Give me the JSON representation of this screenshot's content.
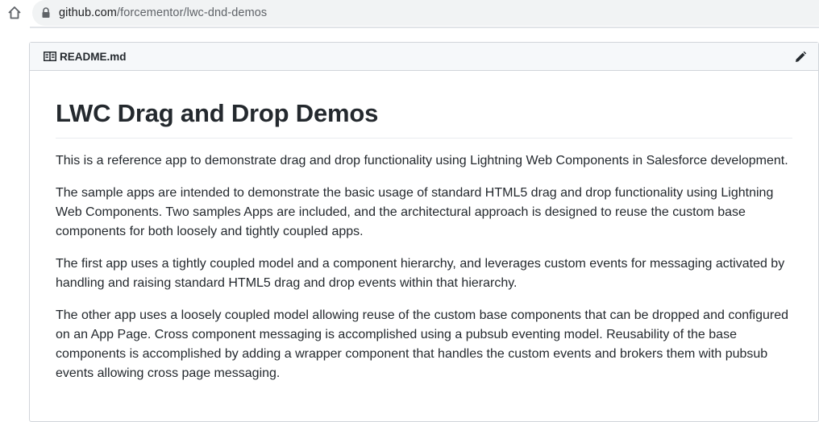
{
  "browser": {
    "url_host": "github.com",
    "url_path": "/forcementor/lwc-dnd-demos"
  },
  "readme": {
    "filename": "README.md",
    "heading": "LWC Drag and Drop Demos",
    "paragraphs": [
      "This is a reference app to demonstrate drag and drop functionality using Lightning Web Components in Salesforce development.",
      "The sample apps are intended to demonstrate the basic usage of standard HTML5 drag and drop functionality using Lightning Web Components. Two samples Apps are included, and the architectural approach is designed to reuse the custom base components for both loosely and tightly coupled apps.",
      "The first app uses a tightly coupled model and a component hierarchy, and leverages custom events for messaging activated by handling and raising standard HTML5 drag and drop events within that hierarchy.",
      "The other app uses a loosely coupled model allowing reuse of the custom base components that can be dropped and configured on an App Page. Cross component messaging is accomplished using a pubsub eventing model. Reusability of the base components is accomplished by adding a wrapper component that handles the custom events and brokers them with pubsub events allowing cross page messaging."
    ]
  },
  "icons": {
    "home": "home-icon",
    "lock": "lock-icon",
    "book": "book-icon",
    "edit": "pencil-icon"
  }
}
